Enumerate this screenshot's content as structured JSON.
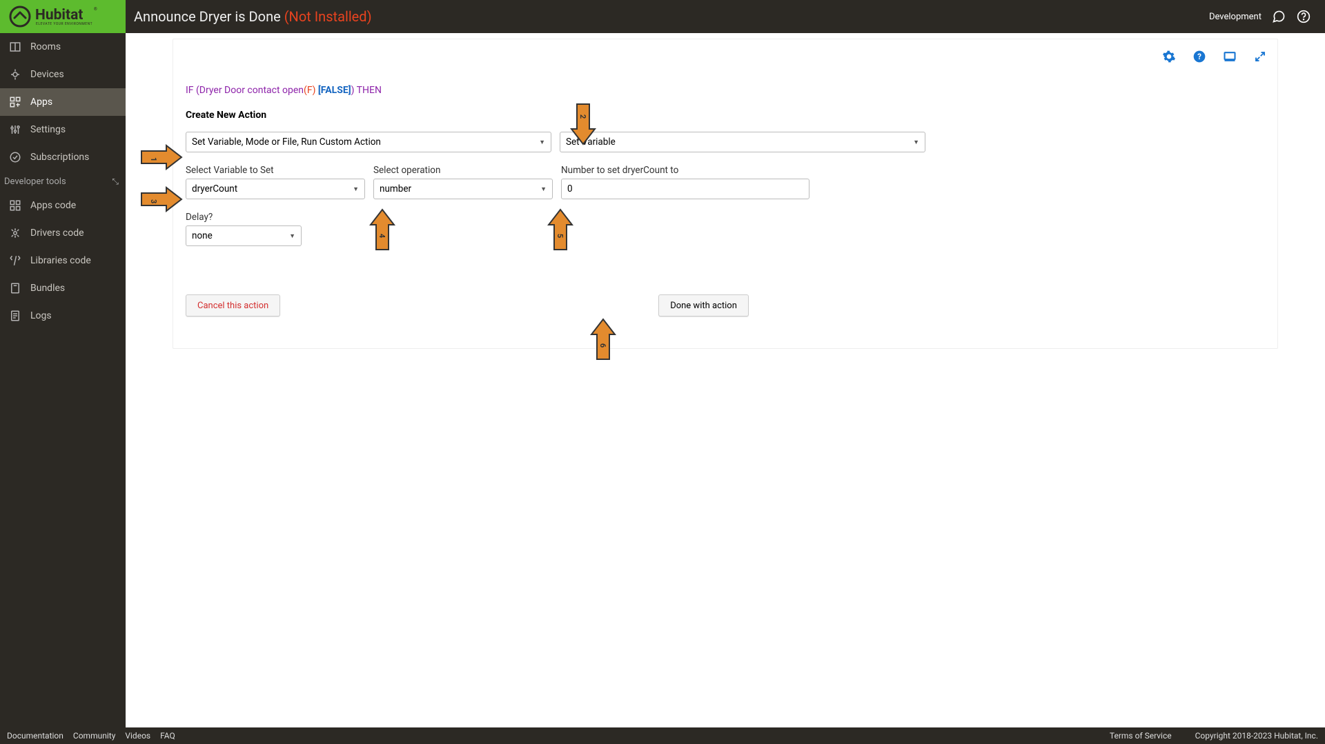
{
  "header": {
    "title": "Announce Dryer is Done",
    "status": "(Not Installed)",
    "env": "Development"
  },
  "sidebar": {
    "items": [
      {
        "label": "Rooms"
      },
      {
        "label": "Devices"
      },
      {
        "label": "Apps"
      },
      {
        "label": "Settings"
      },
      {
        "label": "Subscriptions"
      }
    ],
    "dev_header": "Developer tools",
    "dev_items": [
      {
        "label": "Apps code"
      },
      {
        "label": "Drivers code"
      },
      {
        "label": "Libraries code"
      },
      {
        "label": "Bundles"
      },
      {
        "label": "Logs"
      }
    ]
  },
  "rule": {
    "if": "IF",
    "cond": " (Dryer Door contact open",
    "f": "(F)",
    "false": " [FALSE]",
    "paren": ")",
    "then": " THEN"
  },
  "section_title": "Create New Action",
  "dropdowns": {
    "action_type": "Set Variable, Mode or File, Run Custom Action",
    "sub_action": "Set Variable"
  },
  "labels": {
    "variable": "Select Variable to Set",
    "operation": "Select operation",
    "number": "Number to set dryerCount to",
    "delay": "Delay?"
  },
  "values": {
    "variable": "dryerCount",
    "operation": "number",
    "number": "0",
    "delay": "none"
  },
  "buttons": {
    "cancel": "Cancel this action",
    "done": "Done with action"
  },
  "footer": {
    "links": [
      "Documentation",
      "Community",
      "Videos",
      "FAQ"
    ],
    "tos": "Terms of Service",
    "copyright": "Copyright 2018-2023 Hubitat, Inc."
  }
}
